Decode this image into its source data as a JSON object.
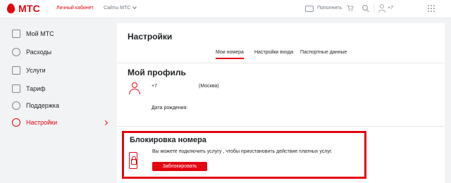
{
  "topbar": {
    "logo_text": "МТС",
    "personal_cabinet": "Личный кабинет",
    "sites_menu": "Сайты МТС",
    "topup": "Пополнить",
    "user_phone": "+7"
  },
  "sidebar": {
    "items": [
      {
        "label": "Мой МТС",
        "icon": "home-icon"
      },
      {
        "label": "Расходы",
        "icon": "expenses-icon"
      },
      {
        "label": "Услуги",
        "icon": "services-icon"
      },
      {
        "label": "Тариф",
        "icon": "tariff-icon"
      },
      {
        "label": "Поддержка",
        "icon": "support-icon"
      },
      {
        "label": "Настройки",
        "icon": "settings-icon",
        "active": true
      }
    ]
  },
  "main": {
    "title": "Настройки",
    "tabs": [
      {
        "label": "Мои номера",
        "active": true
      },
      {
        "label": "Настройки входа"
      },
      {
        "label": "Паспортные данные"
      }
    ],
    "profile": {
      "title": "Мой профиль",
      "phone": "+7",
      "region": "(Москва)",
      "dob_label": "Дата рождения:"
    },
    "block": {
      "title": "Блокировка номера",
      "description": "Вы можете подключить услугу , чтобы приостановить действие платных услуг.",
      "button": "Заблокировать"
    }
  },
  "colors": {
    "brand": "#e30611",
    "background": "#f2f3f5",
    "card": "#ffffff"
  }
}
